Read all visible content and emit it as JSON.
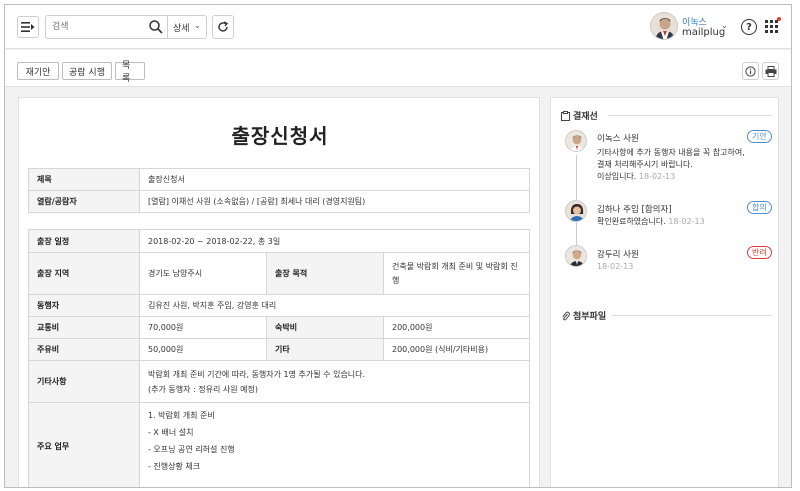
{
  "header": {
    "search_placeholder": "검색",
    "detail_label": "상세",
    "user_name": "이녹스",
    "user_org": "mailplug"
  },
  "toolbar": {
    "buttons": [
      "재기안",
      "공람 시행",
      "목록"
    ]
  },
  "document": {
    "title": "출장신청서",
    "rows": {
      "subject_label": "제목",
      "subject_value": "출장신청서",
      "viewers_label": "열람/공람자",
      "viewers_value": "[열람] 이채선 사원 (소속없음) / [공람] 최세나 대리 (경영지원팀)",
      "period_label": "출장 일정",
      "period_value": "2018-02-20 ~ 2018-02-22, 총 3일",
      "region_label": "출장 지역",
      "region_value": "경기도 남양주시",
      "purpose_label": "출장 목적",
      "purpose_value": "건축물 박람회 개최 준비 및 박람회 진행",
      "companion_label": "동행자",
      "companion_value": "김유진 사원, 박지훈 주임, 강영훈 대리",
      "transport_label": "교통비",
      "transport_value": "70,000원",
      "lodging_label": "숙박비",
      "lodging_value": "200,000원",
      "fuel_label": "주유비",
      "fuel_value": "50,000원",
      "other_label": "기타",
      "other_value": "200,000원 (식비/기타비용)",
      "notes_label": "기타사항",
      "notes_line1": "박람회 개최 준비 기간에 따라, 동행자가 1명 추가될 수 있습니다.",
      "notes_line2": "(추가 동행자 : 정유리 사원 예정)",
      "duties_label": "주요 업무",
      "duties": [
        "1. 박람회 개최 준비",
        "- X 배너 설치",
        "- 오프닝 공연 리허설 진행",
        "- 진행상황 체크"
      ]
    }
  },
  "approval": {
    "section_title": "결재선",
    "steps": [
      {
        "name": "이녹스 사원",
        "badge": "기안",
        "badge_color": "#4a90d9",
        "text": [
          "기타사항에 추가 동행자 내용을 꼭 참고하여,",
          "결재 처리해주시기 바랍니다."
        ],
        "sub": "이상입니다.",
        "date": "18-02-13"
      },
      {
        "name": "김하나 주임 [합의자]",
        "badge": "합의",
        "badge_color": "#4a90d9",
        "sub": "확인완료하였습니다.",
        "date": "18-02-13"
      },
      {
        "name": "강두리 사원",
        "badge": "반려",
        "badge_color": "#e53935",
        "date": "18-02-13"
      }
    ]
  },
  "attachments": {
    "section_title": "첨부파일"
  }
}
